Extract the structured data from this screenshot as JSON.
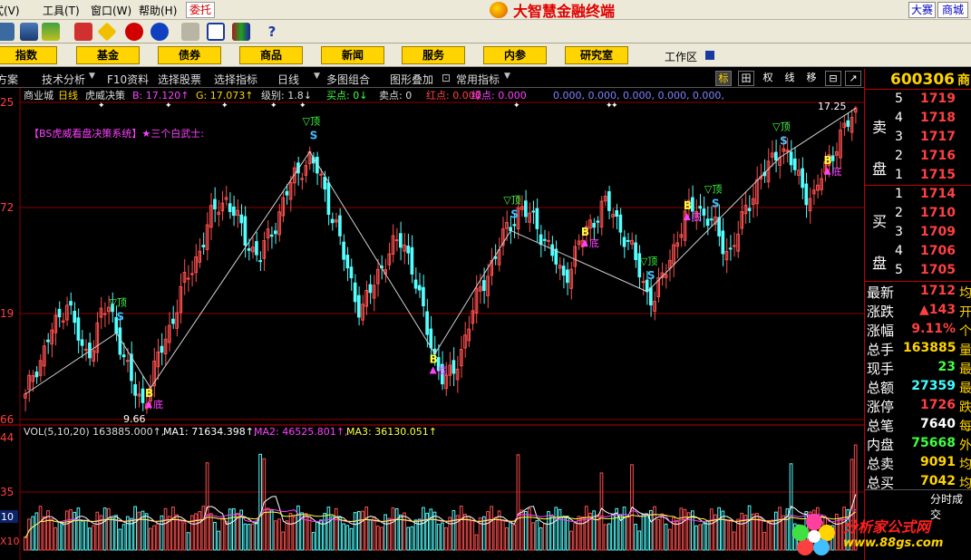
{
  "menubar": {
    "items": [
      "式(V)",
      "工具(T)",
      "窗口(W)",
      "帮助(H)"
    ],
    "entrust": "委托",
    "brand": "大智慧金融终端",
    "right_buttons": [
      "大赛",
      "商城"
    ]
  },
  "toolbar": {
    "icons": [
      "binoculars-icon",
      "chart-icon",
      "alert-icon",
      "diamond-icon",
      "red-chip-icon",
      "blue-chip-icon",
      "print-icon",
      "window-icon",
      "books-icon",
      "help-icon"
    ]
  },
  "navbar": {
    "buttons": [
      "指数",
      "基金",
      "债券",
      "商品",
      "新闻",
      "服务",
      "内参",
      "研究室"
    ],
    "workarea": "工作区"
  },
  "funcbar": {
    "items": [
      "方案",
      "技术分析",
      "F10资料",
      "选择股票",
      "选择指标",
      "日线",
      "多图组合",
      "图形叠加",
      "常用指标"
    ],
    "tools": [
      "标",
      "田",
      "权",
      "线",
      "移",
      "⊟",
      "↗"
    ]
  },
  "chart": {
    "header": {
      "name": "商业城",
      "period": "日线",
      "indicator": "虎威决策",
      "b_label": "B: 17.120↑",
      "g_label": "G: 17.073↑",
      "level": "级别: 1.8↓",
      "buy_point": "买点: 0↓",
      "sell_point": "卖点: 0",
      "red_point": "红点: 0.000",
      "green_point": "绿点: 0.000",
      "tail": "0.000, 0.000, 0.000, 0.000, 0.000,"
    },
    "system_title": "【BS虎威看盘决策系统】★三个白武士:",
    "high_label": "17.25",
    "low_label": "9.66",
    "y_ticks": [
      "25",
      "72",
      "19",
      "66"
    ],
    "vol_ticks": [
      "44",
      "35",
      "10",
      "X10"
    ],
    "volume_header": {
      "vol": "VOL(5,10,20) 163885.000↑,",
      "ma1": "MA1: 71634.398↑,",
      "ma2": "MA2: 46525.801↑,",
      "ma3": "MA3: 36130.051↑"
    },
    "signals": {
      "top": "▽顶",
      "bottom": "底",
      "buy": "B",
      "sell": "S"
    }
  },
  "chart_data": {
    "type": "candlestick",
    "price_ticks": [
      "25",
      "72",
      "19",
      "66"
    ],
    "high": 17.25,
    "low": 9.66,
    "close_path": [
      10.2,
      10.9,
      11.2,
      11.8,
      12.1,
      12.6,
      11.9,
      11.2,
      11.5,
      12.2,
      12.4,
      11.8,
      11.0,
      10.4,
      10.1,
      10.6,
      11.3,
      11.8,
      12.4,
      13.0,
      13.4,
      13.9,
      14.5,
      14.9,
      15.0,
      14.6,
      14.2,
      13.8,
      13.6,
      14.1,
      14.5,
      15.1,
      15.5,
      15.8,
      16.0,
      15.6,
      15.0,
      14.4,
      13.6,
      12.9,
      12.3,
      12.7,
      13.2,
      13.6,
      13.9,
      14.0,
      13.5,
      12.6,
      11.8,
      11.1,
      10.6,
      10.8,
      11.4,
      12.1,
      12.7,
      13.2,
      13.6,
      14.1,
      14.5,
      14.8,
      14.6,
      14.4,
      14.0,
      13.6,
      13.1,
      13.4,
      13.9,
      14.3,
      14.6,
      14.9,
      14.7,
      14.3,
      13.9,
      13.4,
      12.8,
      12.6,
      13.1,
      13.7,
      14.2,
      14.7,
      14.9,
      14.6,
      14.4,
      14.0,
      13.7,
      14.2,
      14.8,
      15.3,
      15.6,
      15.9,
      16.3,
      16.0,
      15.6,
      15.2,
      15.0,
      15.6,
      16.1,
      16.4,
      16.8,
      17.12
    ],
    "volume_series": [
      {
        "name": "VOL",
        "last": 163885.0
      },
      {
        "name": "MA1",
        "last": 71634.398
      },
      {
        "name": "MA2",
        "last": 46525.801
      },
      {
        "name": "MA3",
        "last": 36130.051
      }
    ],
    "colors": {
      "up": "#ff5050",
      "down": "#54ffff",
      "ma1": "#ffffff",
      "ma2": "#ff40ff",
      "ma3": "#ffff40",
      "grid": "#8b0000"
    }
  },
  "quote": {
    "code": "600306",
    "code_suffix": "商",
    "sell_side": "卖盘",
    "buy_side": "买盘",
    "asks": [
      {
        "level": "5",
        "price": "1719"
      },
      {
        "level": "4",
        "price": "1718"
      },
      {
        "level": "3",
        "price": "1717"
      },
      {
        "level": "2",
        "price": "1716"
      },
      {
        "level": "1",
        "price": "1715"
      }
    ],
    "bids": [
      {
        "level": "1",
        "price": "1714"
      },
      {
        "level": "2",
        "price": "1710"
      },
      {
        "level": "3",
        "price": "1709"
      },
      {
        "level": "4",
        "price": "1706"
      },
      {
        "level": "5",
        "price": "1705"
      }
    ],
    "stats": [
      {
        "label": "最新",
        "value": "1712",
        "color": "#ff4040",
        "cut": "均"
      },
      {
        "label": "涨跌",
        "value": "▲143",
        "color": "#ff4040",
        "cut": "开"
      },
      {
        "label": "涨幅",
        "value": "9.11%",
        "color": "#ff4040",
        "cut": "个"
      },
      {
        "label": "总手",
        "value": "163885",
        "color": "#ffd400",
        "cut": "量"
      },
      {
        "label": "现手",
        "value": "23",
        "color": "#40ff40",
        "cut": "最"
      },
      {
        "label": "总额",
        "value": "27359",
        "color": "#40ffff",
        "cut": "最"
      },
      {
        "label": "涨停",
        "value": "1726",
        "color": "#ff4040",
        "cut": "跌"
      },
      {
        "label": "总笔",
        "value": "7640",
        "color": "#ffffff",
        "cut": "每"
      },
      {
        "label": "内盘",
        "value": "75668",
        "color": "#40ff40",
        "cut": "外"
      },
      {
        "label": "总卖",
        "value": "9091",
        "color": "#ffd400",
        "cut": "均"
      },
      {
        "label": "总买",
        "value": "7042",
        "color": "#ffd400",
        "cut": "均"
      }
    ],
    "time_share": "分时成交"
  },
  "watermark": {
    "title": "分析家公式网",
    "url": "www.88gs.com"
  }
}
